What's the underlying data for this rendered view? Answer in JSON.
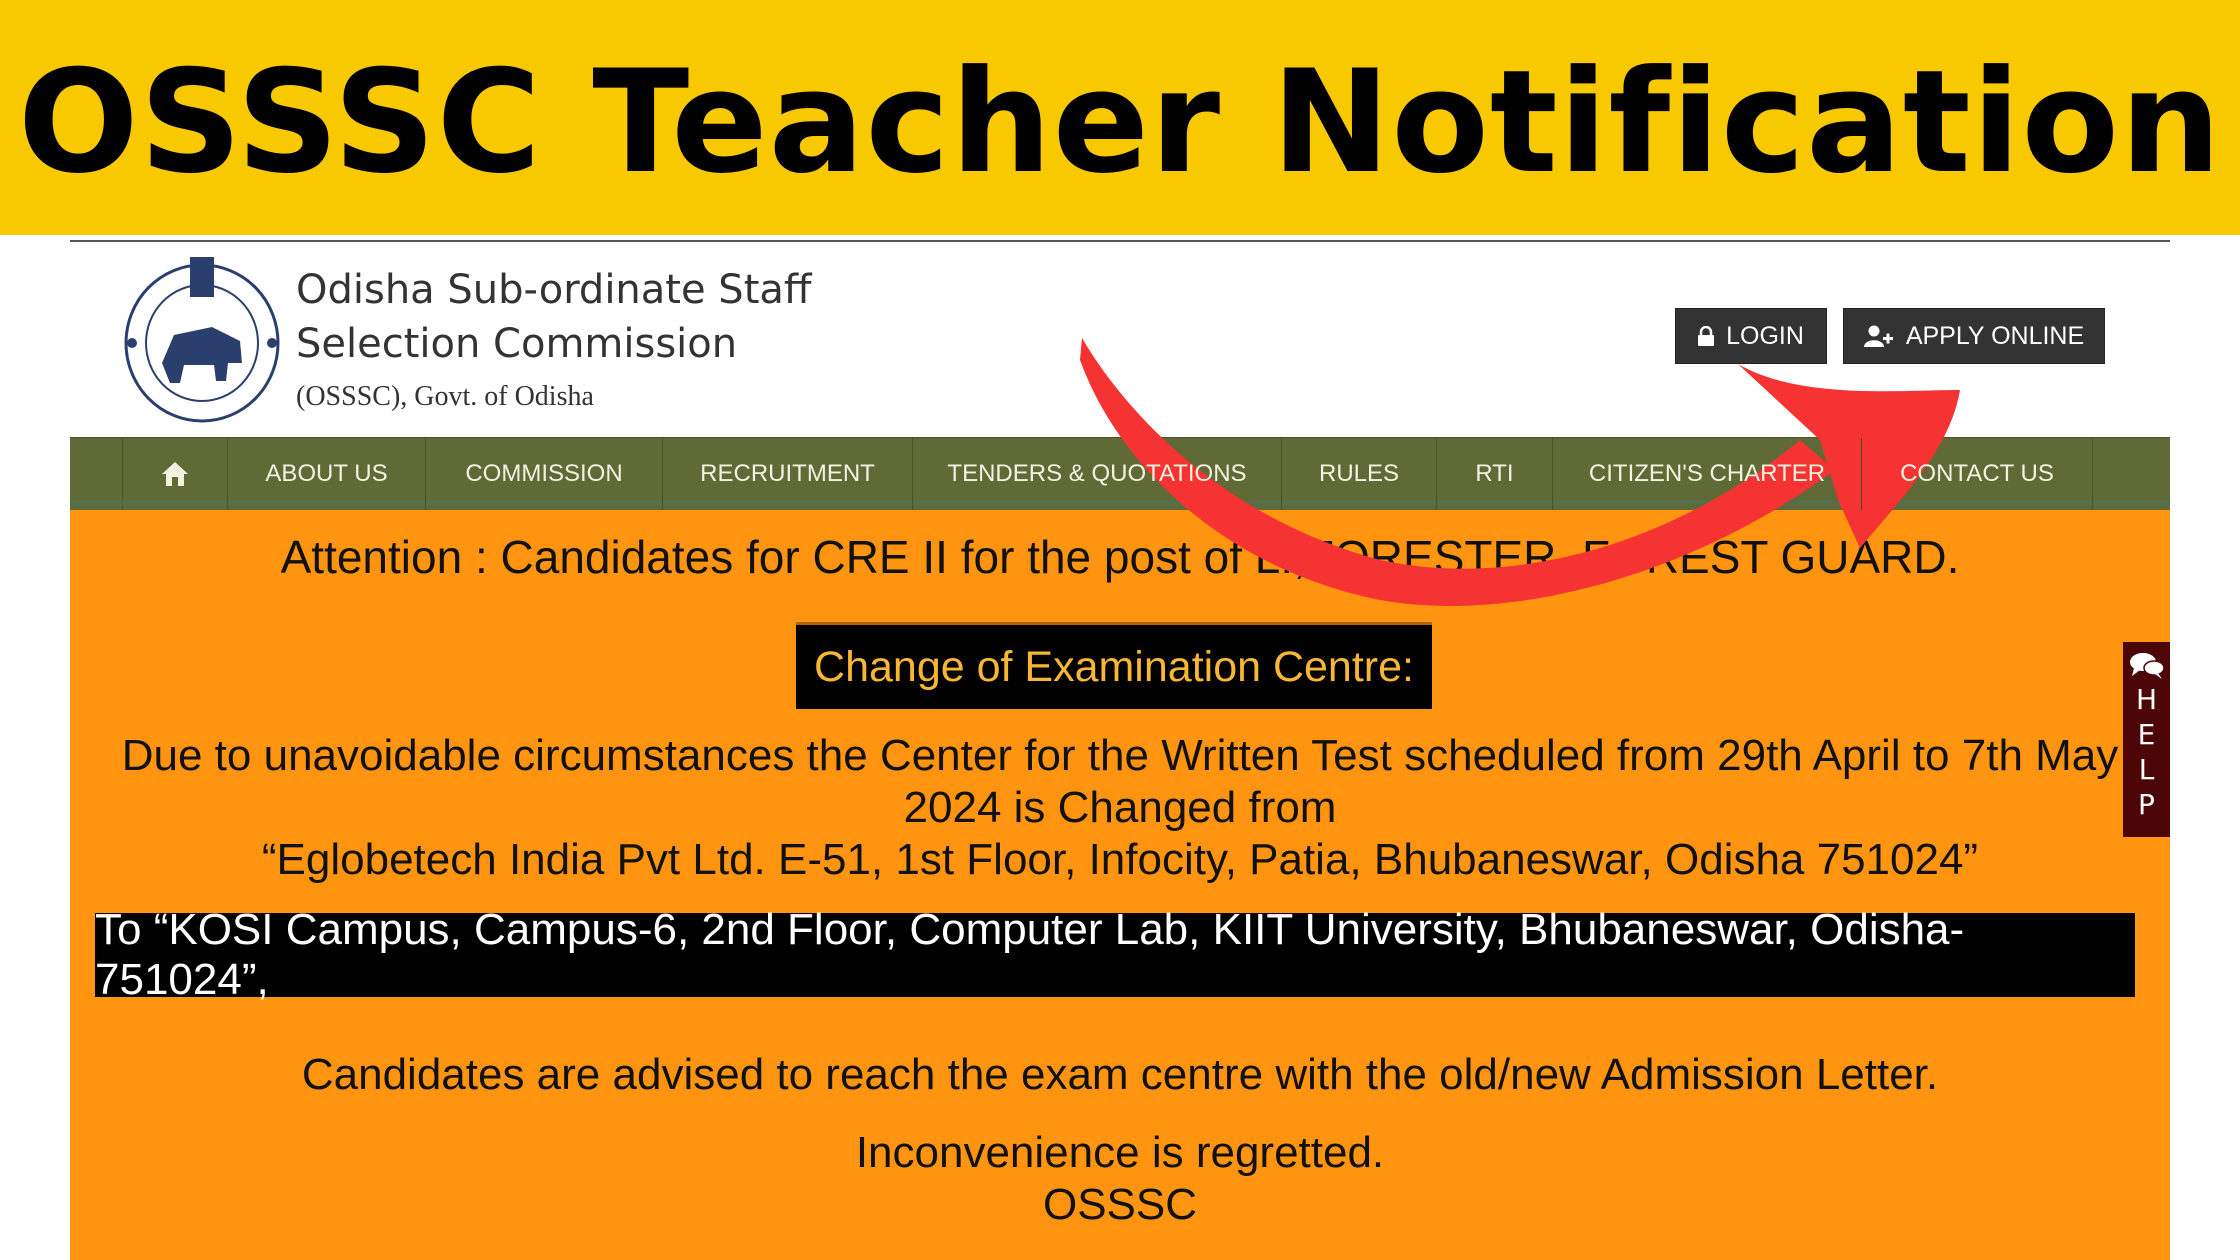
{
  "banner": {
    "title": "OSSSC Teacher Notification"
  },
  "header": {
    "org_name_line1": "Odisha Sub-ordinate Staff",
    "org_name_line2": "Selection Commission",
    "org_sub": "(OSSSC), Govt. of Odisha",
    "login_label": "LOGIN",
    "apply_label": "APPLY ONLINE"
  },
  "nav": {
    "items": [
      {
        "label": "ABOUT US"
      },
      {
        "label": "COMMISSION"
      },
      {
        "label": "RECRUITMENT"
      },
      {
        "label": "TENDERS & QUOTATIONS"
      },
      {
        "label": "RULES"
      },
      {
        "label": "RTI"
      },
      {
        "label": "CITIZEN'S CHARTER"
      },
      {
        "label": "CONTACT US"
      }
    ]
  },
  "notice": {
    "attention": "Attention : Candidates for CRE II for the post of LI,FORESTER, FOREST GUARD.",
    "heading": "Change of Examination Centre:",
    "para_line1": "Due to unavoidable circumstances the Center for the Written Test scheduled from 29th April to 7th May",
    "para_line2": "2024 is Changed from",
    "para_line3": "“Eglobetech India Pvt Ltd. E-51, 1st Floor, Infocity, Patia, Bhubaneswar, Odisha 751024”",
    "to_address": "To “KOSI Campus, Campus-6, 2nd Floor, Computer Lab, KIIT University, Bhubaneswar, Odisha-751024”,",
    "advise": "Candidates are advised to reach the exam centre with the old/new Admission Letter.",
    "regret": "Inconvenience is regretted.",
    "signature": "OSSSC"
  },
  "help": {
    "letters": [
      "H",
      "E",
      "L",
      "P"
    ]
  },
  "colors": {
    "banner": "#F8C800",
    "nav": "#5F6A36",
    "notice_bg": "#FF9410",
    "arrow": "#F53333",
    "help_bg": "#4C0608"
  }
}
